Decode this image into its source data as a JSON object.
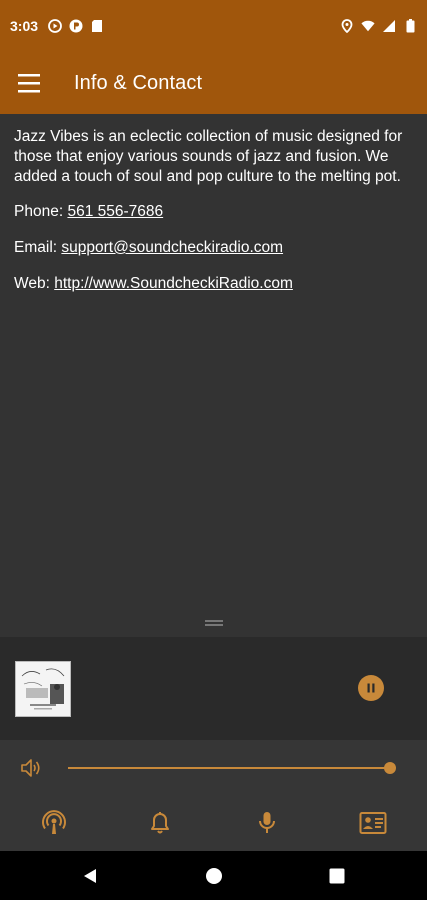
{
  "status_bar": {
    "time": "3:03",
    "left_icons": [
      "play-circle-icon",
      "podcast-app-icon",
      "sd-card-icon"
    ],
    "right_icons": [
      "location-icon",
      "wifi-icon",
      "cell-signal-icon",
      "battery-icon"
    ]
  },
  "app_bar": {
    "title": "Info & Contact",
    "menu_icon": "hamburger-menu-icon"
  },
  "content": {
    "description": "Jazz Vibes is an eclectic collection of music designed for those that enjoy various sounds of jazz and fusion. We added a touch of soul and pop culture to the melting pot.",
    "phone_label": "Phone:",
    "phone_value": "561 556-7686",
    "email_label": "Email:",
    "email_value": "support@soundcheckiradio.com",
    "web_label": "Web:",
    "web_value": "http://www.SoundcheckiRadio.com"
  },
  "player": {
    "album_art_icon": "album-art-thumbnail",
    "pause_icon": "pause-icon",
    "volume_level": 1.0
  },
  "bottom_nav": {
    "items": [
      "podcast-icon",
      "bell-icon",
      "microphone-icon",
      "contact-card-icon"
    ]
  },
  "colors": {
    "brand": "#a0560c",
    "accent": "#c8893a",
    "content_bg": "#333333",
    "player_bg": "#2a2a2a",
    "bottom_bg": "#363636"
  }
}
